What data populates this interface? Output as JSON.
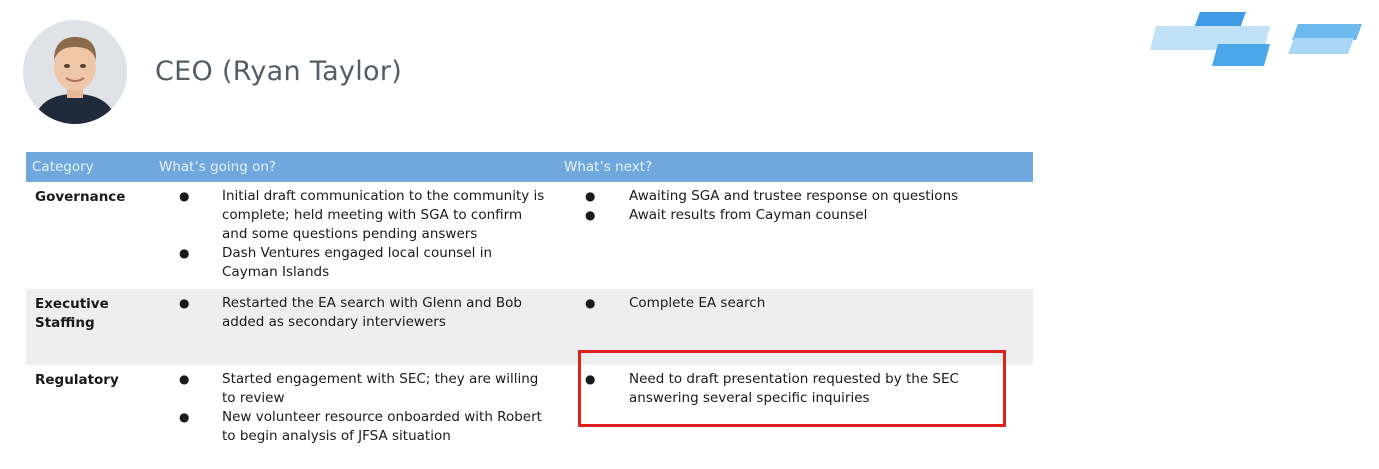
{
  "header": {
    "title": "CEO (Ryan Taylor)"
  },
  "table": {
    "headers": [
      "Category",
      "What’s going on?",
      "What’s next?"
    ],
    "rows": [
      {
        "category": "Governance",
        "going_on": [
          "Initial draft communication to the community is complete; held meeting with SGA to confirm and some questions pending answers",
          "Dash Ventures engaged local counsel in Cayman Islands"
        ],
        "next": [
          "Awaiting SGA and trustee response on questions",
          "Await results from Cayman counsel"
        ]
      },
      {
        "category": "Executive Staffing",
        "going_on": [
          "Restarted the EA search with Glenn and Bob added as secondary interviewers"
        ],
        "next": [
          "Complete EA search"
        ]
      },
      {
        "category": "Regulatory",
        "going_on": [
          "Started engagement with SEC; they are willing to review",
          "New volunteer resource onboarded with Robert to begin analysis of JFSA situation"
        ],
        "next": [
          "Need to draft presentation requested by the SEC answering several specific inquiries"
        ]
      }
    ]
  },
  "bullet": "●",
  "colors": {
    "header_bg": "#6fa8dc",
    "row_shade": "#eeeeee",
    "highlight_border": "#e02020",
    "logo_blue": "#4aa3e8"
  }
}
